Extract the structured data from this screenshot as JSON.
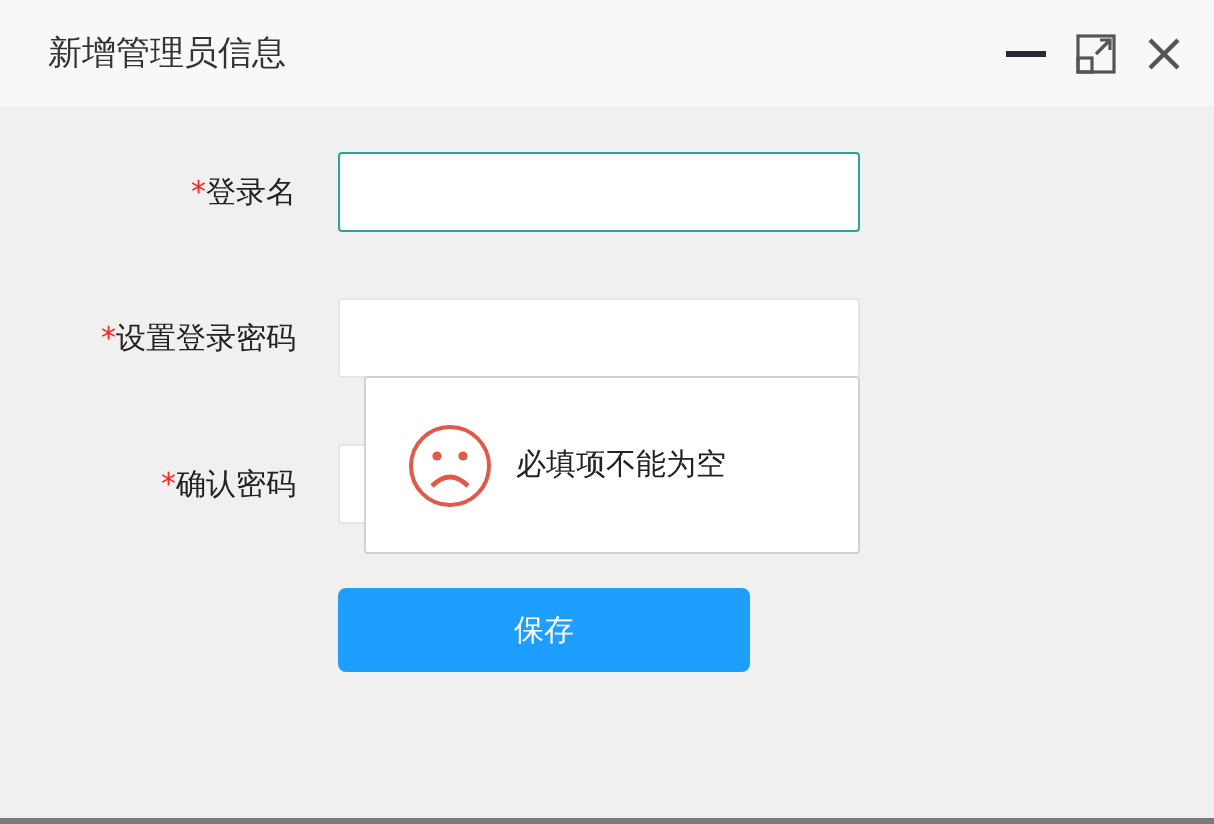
{
  "window": {
    "title": "新增管理员信息"
  },
  "fields": [
    {
      "required_mark": "*",
      "label": "登录名",
      "focused": true
    },
    {
      "required_mark": "*",
      "label": "设置登录密码",
      "focused": false
    },
    {
      "required_mark": "*",
      "label": "确认密码",
      "focused": false
    }
  ],
  "save_button": {
    "label": "保存"
  },
  "error_tooltip": {
    "message": "必填项不能为空"
  }
}
